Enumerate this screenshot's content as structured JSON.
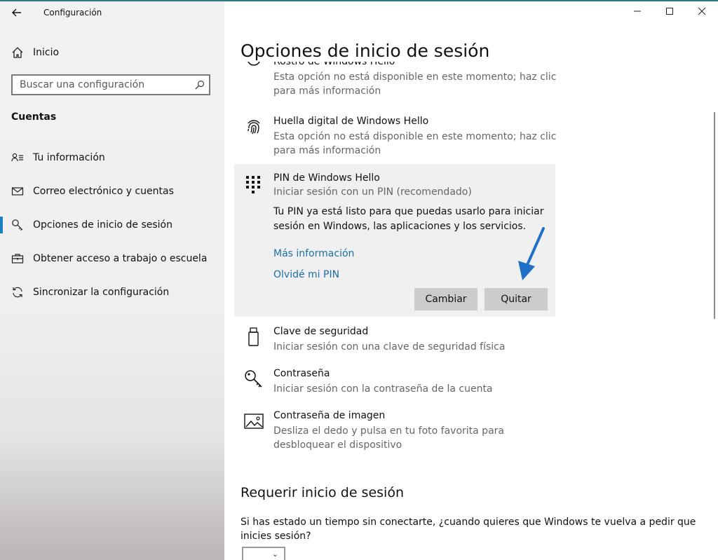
{
  "window": {
    "title": "Configuración",
    "back_icon": "arrow-left-icon",
    "controls": [
      "minimize-icon",
      "maximize-icon",
      "close-icon"
    ]
  },
  "sidebar": {
    "home_label": "Inicio",
    "search_placeholder": "Buscar una configuración",
    "section_title": "Cuentas",
    "items": [
      {
        "label": "Tu información",
        "icon": "person-card-icon",
        "selected": false
      },
      {
        "label": "Correo electrónico y cuentas",
        "icon": "mail-icon",
        "selected": false
      },
      {
        "label": "Opciones de inicio de sesión",
        "icon": "key-icon",
        "selected": true
      },
      {
        "label": "Obtener acceso a trabajo o escuela",
        "icon": "briefcase-icon",
        "selected": false
      },
      {
        "label": "Sincronizar la configuración",
        "icon": "sync-icon",
        "selected": false
      }
    ]
  },
  "main": {
    "title": "Opciones de inicio de sesión",
    "options": {
      "face": {
        "title": "Rostro de Windows Hello",
        "desc": "Esta opción no está disponible en este momento; haz clic para más información",
        "icon": "face-icon"
      },
      "fingerprint": {
        "title": "Huella digital de Windows Hello",
        "desc": "Esta opción no está disponible en este momento; haz clic para más información",
        "icon": "fingerprint-icon"
      },
      "pin": {
        "title": "PIN de Windows Hello",
        "desc": "Iniciar sesión con un PIN (recomendado)",
        "body": "Tu PIN ya está listo para que puedas usarlo para iniciar sesión en Windows, las aplicaciones y los servicios.",
        "link_more": "Más información",
        "link_forgot": "Olvidé mi PIN",
        "btn_change": "Cambiar",
        "btn_remove": "Quitar",
        "icon": "keypad-icon"
      },
      "security_key": {
        "title": "Clave de seguridad",
        "desc": "Iniciar sesión con una clave de seguridad física",
        "icon": "usb-key-icon"
      },
      "password": {
        "title": "Contraseña",
        "desc": "Iniciar sesión con la contraseña de la cuenta",
        "icon": "key-icon"
      },
      "picture_password": {
        "title": "Contraseña de imagen",
        "desc": "Desliza el dedo y pulsa en tu foto favorita para desbloquear el dispositivo",
        "icon": "picture-icon"
      }
    },
    "require_section": {
      "title": "Requerir inicio de sesión",
      "question": "Si has estado un tiempo sin conectarte, ¿cuando quieres que Windows te vuelva a pedir que inicies sesión?",
      "dropdown_value": ""
    }
  },
  "colors": {
    "accent": "#1e7fbe",
    "link": "#1d6fa3",
    "annotation_arrow": "#1f6fc9"
  }
}
